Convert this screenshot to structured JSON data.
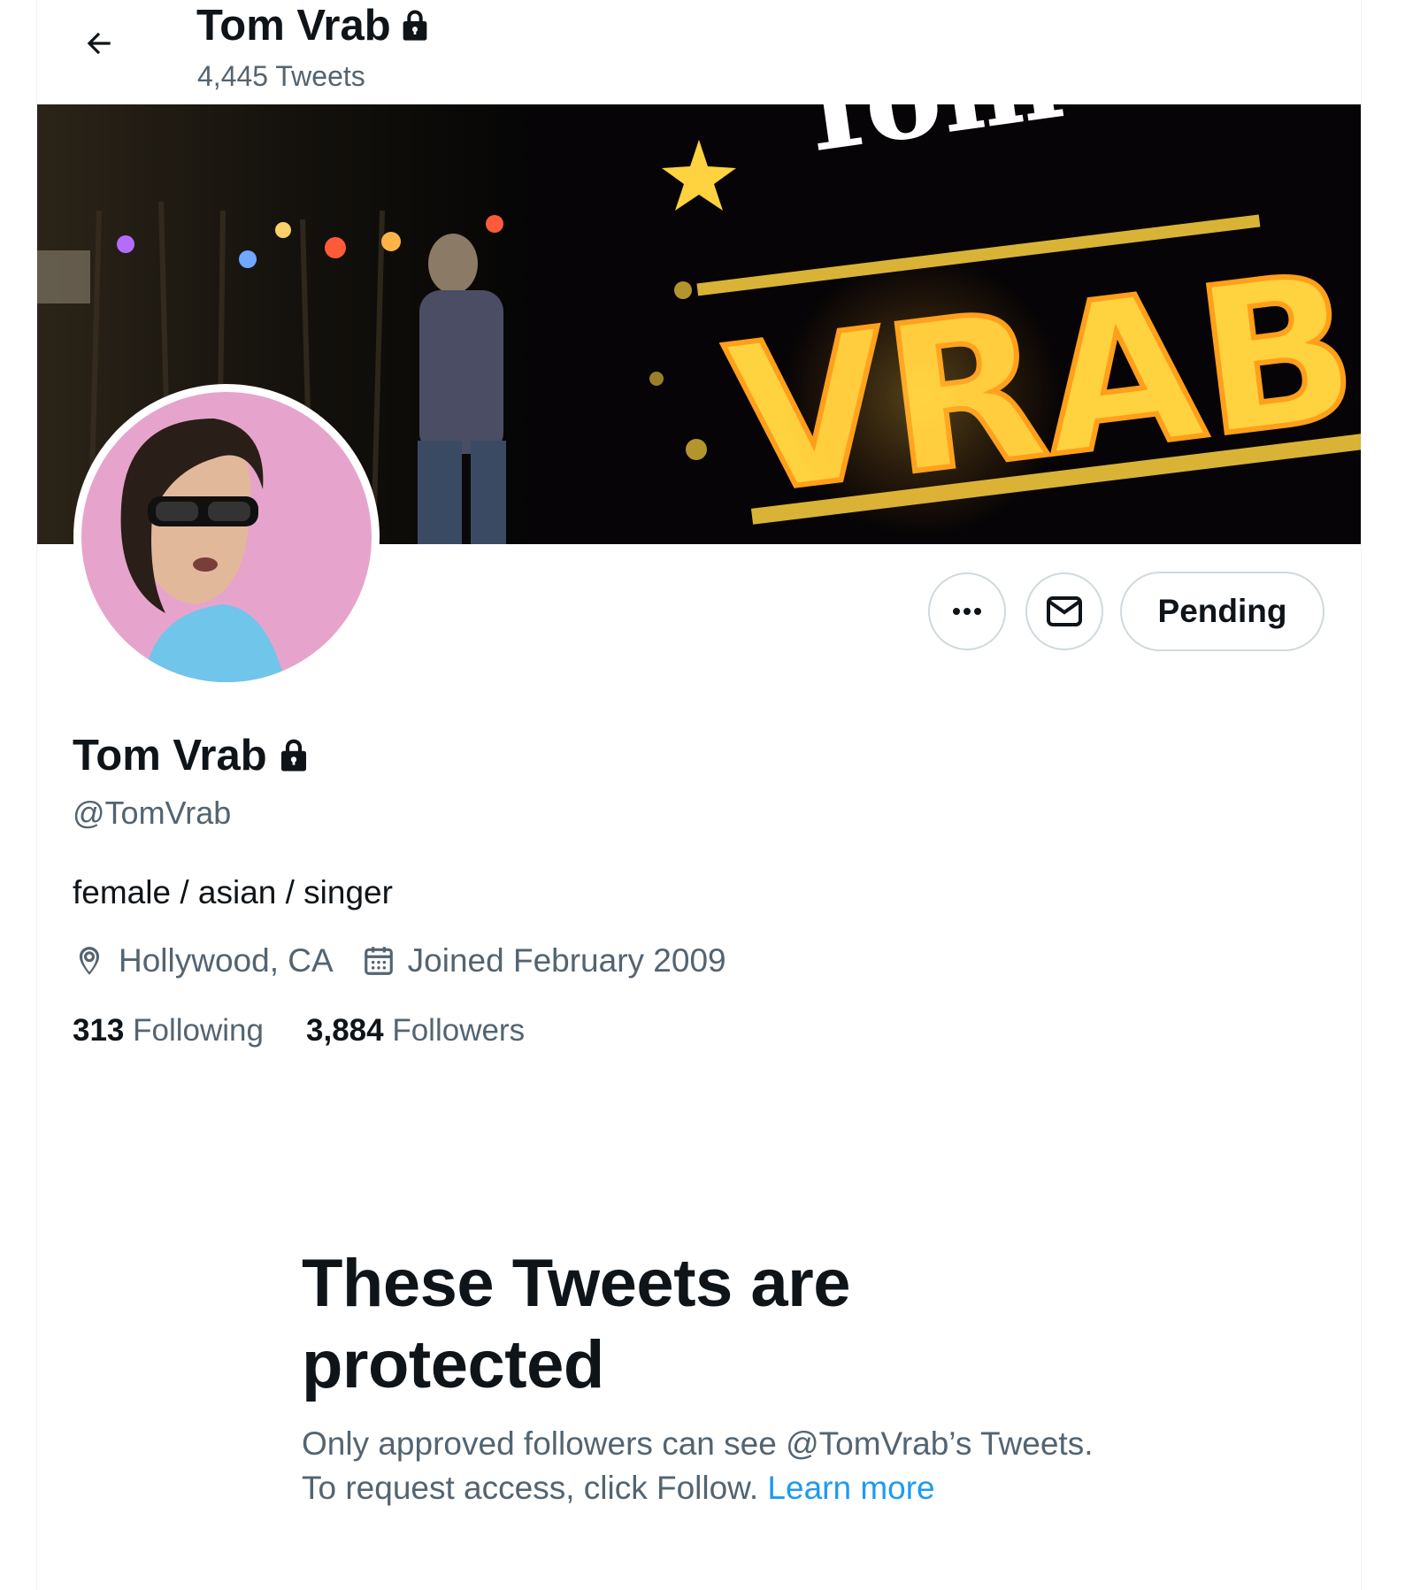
{
  "header": {
    "name": "Tom Vrab",
    "tweet_count": "4,445 Tweets",
    "back_icon": "arrow-left-icon",
    "lock_icon": "lock-icon"
  },
  "banner": {
    "description_hidden": true,
    "sign_text_top": "Tom",
    "sign_text_main": "VRAB"
  },
  "actions": {
    "more_icon": "ellipsis-icon",
    "message_icon": "envelope-icon",
    "pending_label": "Pending"
  },
  "profile": {
    "name": "Tom Vrab",
    "handle": "@TomVrab",
    "bio": "female / asian / singer",
    "location": "Hollywood, CA",
    "joined": "Joined February 2009",
    "following_count": "313",
    "following_label": "Following",
    "followers_count": "3,884",
    "followers_label": "Followers"
  },
  "protected": {
    "title": "These Tweets are protected",
    "body": "Only approved followers can see @TomVrab’s Tweets. To request access, click Follow.",
    "learn_more": "Learn more"
  },
  "colors": {
    "text_primary": "#0f1419",
    "text_secondary": "#536471",
    "link": "#1d9bf0",
    "border": "#cfd9de",
    "avatar_bg": "#e6a4cc"
  }
}
